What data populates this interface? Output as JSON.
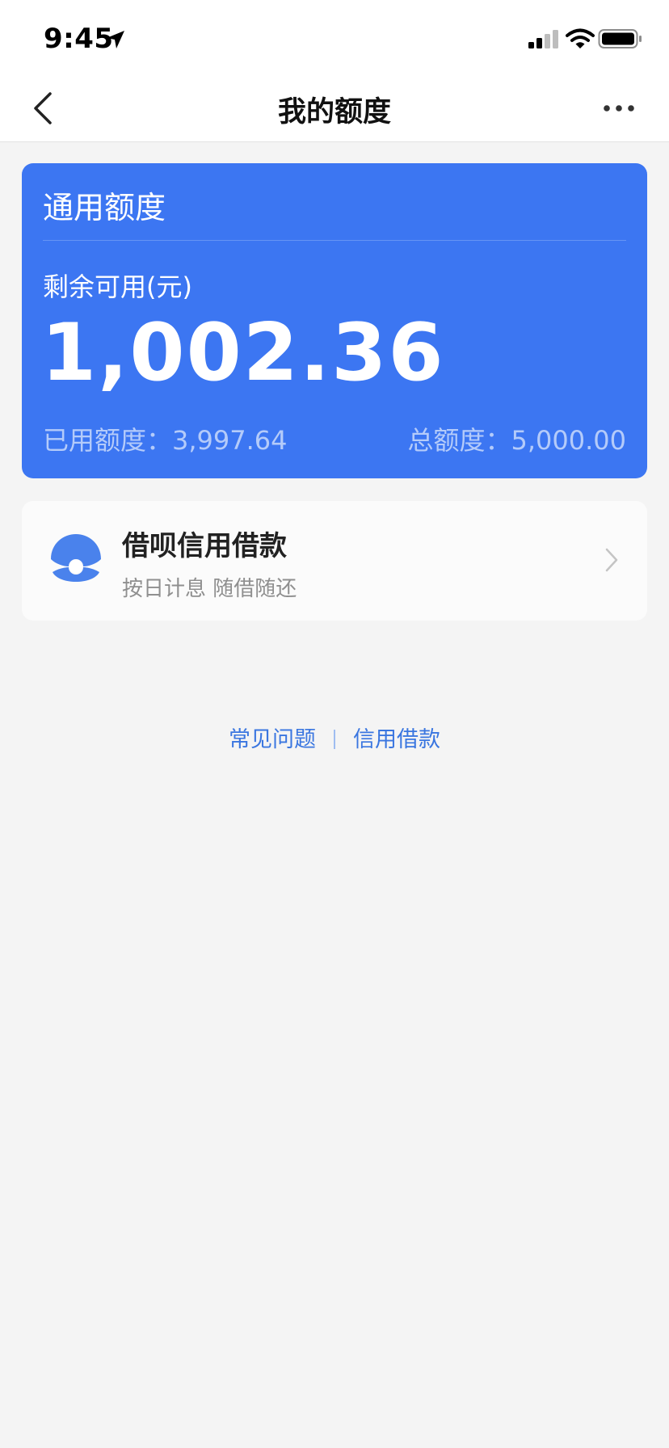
{
  "status_bar": {
    "time": "9:45",
    "icons": [
      "location-arrow-icon",
      "signal-icon",
      "wifi-icon",
      "battery-icon"
    ]
  },
  "nav": {
    "title": "我的额度",
    "back_icon": "chevron-left-icon",
    "more_icon": "more-dots-icon"
  },
  "quota_card": {
    "title": "通用额度",
    "available_label": "剩余可用(元)",
    "available_amount": "1,002.36",
    "used_text": "已用额度：3,997.64",
    "total_text": "总额度：5,000.00",
    "color": "#3c76f2"
  },
  "product": {
    "name": "借呗信用借款",
    "subtitle": "按日计息 随借随还",
    "logo_icon": "jiebei-shell-icon",
    "arrow_icon": "chevron-right-icon"
  },
  "footer": {
    "link1": "常见问题",
    "link2": "信用借款",
    "link_color": "#3a76e0"
  }
}
